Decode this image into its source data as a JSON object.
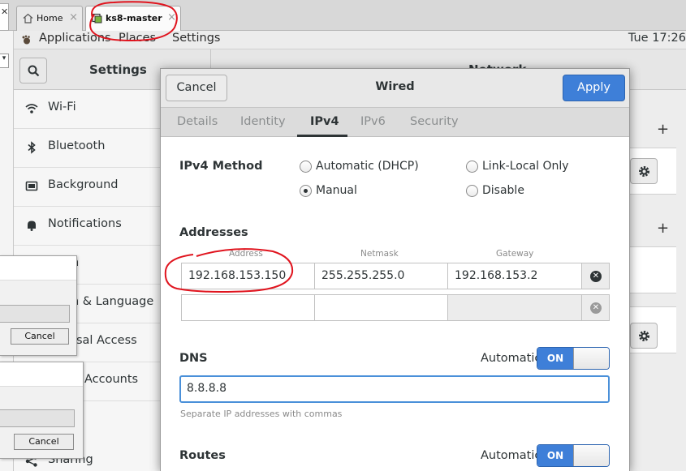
{
  "vm_tabs": [
    {
      "label": "Home",
      "icon": "home-icon"
    },
    {
      "label": "ks8-master",
      "icon": "vm-icon"
    }
  ],
  "top_bar": {
    "applications": "Applications",
    "places": "Places",
    "settings": "Settings",
    "clock": "Tue 17:26"
  },
  "settings": {
    "title": "Settings",
    "panel_title": "Network",
    "sidebar": [
      {
        "label": "Wi-Fi",
        "icon": "wifi-icon"
      },
      {
        "label": "Bluetooth",
        "icon": "bluetooth-icon"
      },
      {
        "label": "Background",
        "icon": "background-icon"
      },
      {
        "label": "Notifications",
        "icon": "bell-icon"
      },
      {
        "label": "h",
        "icon": "search-icon"
      },
      {
        "label": "n & Language",
        "icon": "flag-icon"
      },
      {
        "label": "rsal Access",
        "icon": "accessibility-icon"
      },
      {
        "label": "Accounts",
        "icon": "accounts-icon"
      },
      {
        "label": "Sharing",
        "icon": "share-icon"
      }
    ]
  },
  "small_windows": [
    {
      "button": "Cancel"
    },
    {
      "button": "Cancel"
    }
  ],
  "dialog": {
    "title": "Wired",
    "cancel": "Cancel",
    "apply": "Apply",
    "tabs": [
      "Details",
      "Identity",
      "IPv4",
      "IPv6",
      "Security"
    ],
    "active_tab": "IPv4",
    "ipv4_method_label": "IPv4 Method",
    "methods": [
      {
        "label": "Automatic (DHCP)",
        "selected": false
      },
      {
        "label": "Link-Local Only",
        "selected": false
      },
      {
        "label": "Manual",
        "selected": true
      },
      {
        "label": "Disable",
        "selected": false
      }
    ],
    "addresses_label": "Addresses",
    "columns": [
      "Address",
      "Netmask",
      "Gateway"
    ],
    "rows": [
      {
        "address": "192.168.153.150",
        "netmask": "255.255.255.0",
        "gateway": "192.168.153.2"
      },
      {
        "address": "",
        "netmask": "",
        "gateway": ""
      }
    ],
    "dns_label": "DNS",
    "dns_automatic_label": "Automatic",
    "dns_switch": "ON",
    "dns_value": "8.8.8.8",
    "dns_hint": "Separate IP addresses with commas",
    "routes_label": "Routes",
    "routes_automatic_label": "Automatic",
    "routes_switch": "ON"
  },
  "colors": {
    "accent": "#3e7fd8",
    "annotation": "#e0141e"
  }
}
